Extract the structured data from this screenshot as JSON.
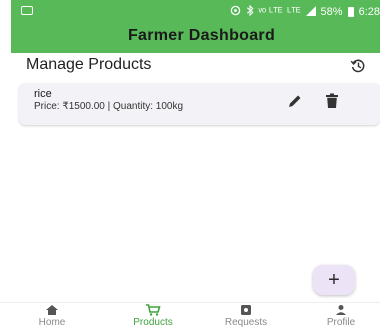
{
  "status_bar": {
    "icons": [
      "nfc-icon",
      "bluetooth-icon",
      "volte-icon",
      "lte-icon",
      "signal-icon",
      "battery-icon"
    ],
    "volte_text": "ᵛᵒ ᴸᵀᴱ",
    "lte_text": "ᴸᵀᴱ",
    "battery_percent": "58%",
    "time": "6:28"
  },
  "header": {
    "title": "Farmer Dashboard",
    "color": "#57b957"
  },
  "page": {
    "title": "Manage Products",
    "history_icon": "history-icon"
  },
  "products": [
    {
      "name": "rice",
      "detail": "Price: ₹1500.00 | Quantity: 100kg"
    }
  ],
  "fab": {
    "label": "+"
  },
  "bottom_nav": [
    {
      "label": "Home",
      "icon": "home-icon",
      "active": false
    },
    {
      "label": "Products",
      "icon": "cart-icon",
      "active": true
    },
    {
      "label": "Requests",
      "icon": "request-icon",
      "active": false
    },
    {
      "label": "Profile",
      "icon": "person-icon",
      "active": false
    }
  ],
  "colors": {
    "accent": "#57b957",
    "active_nav": "#3fa33f",
    "card_bg": "#f3f2f6",
    "fab_bg": "#ece4f6"
  }
}
